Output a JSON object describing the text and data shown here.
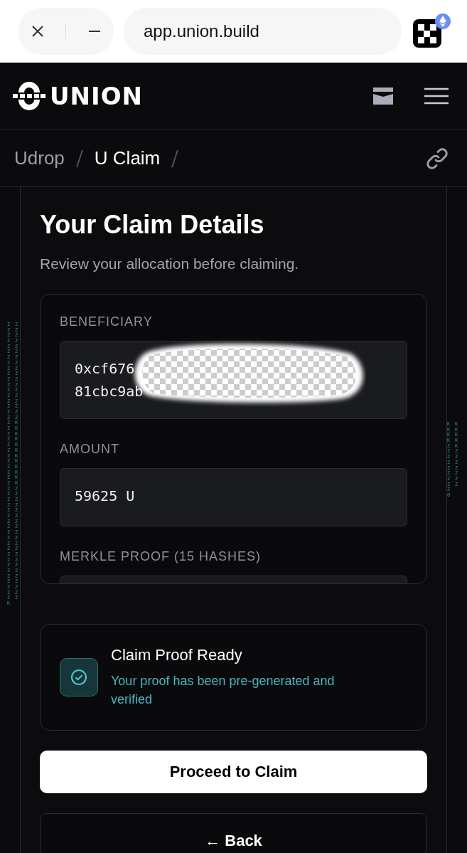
{
  "browser": {
    "url": "app.union.build"
  },
  "header": {
    "logo_text": "UNION"
  },
  "breadcrumb": [
    {
      "label": "Udrop",
      "selected": false
    },
    {
      "label": "U Claim",
      "selected": true
    }
  ],
  "card": {
    "title": "Your Claim Details",
    "subtitle": "Review your allocation before claiming.",
    "fields": [
      {
        "label": "BENEFICIARY",
        "lines": [
          "0xcf676",
          "81cbc9ab"
        ],
        "redacted": true
      },
      {
        "label": "AMOUNT",
        "lines": [
          "59625 U"
        ],
        "redacted": false
      },
      {
        "label": "MERKLE PROOF (15 HASHES)",
        "redacted": false
      }
    ]
  },
  "status": {
    "title": "Claim Proof Ready",
    "message": "Your proof has been pre-generated and verified"
  },
  "buttons": [
    {
      "label": "Proceed to Claim",
      "kind": "primary"
    },
    {
      "label": "← Back",
      "kind": "secondary"
    }
  ],
  "rain_left": [
    "ZZZZZZZZZZZZZZZZZZZZZZZZZZZZZZZZZZZZZZZZZZZZZZZZZZZK",
    "ZZZZZZZZZZZZZZZZZZKKKKKKKKKKKKZZZZZZZZZZZZZZZZZZZZZ"
  ],
  "rain_right": [
    "KKKKZZZZZZZZZ0",
    "KKKKKZZZZZZZ"
  ]
}
